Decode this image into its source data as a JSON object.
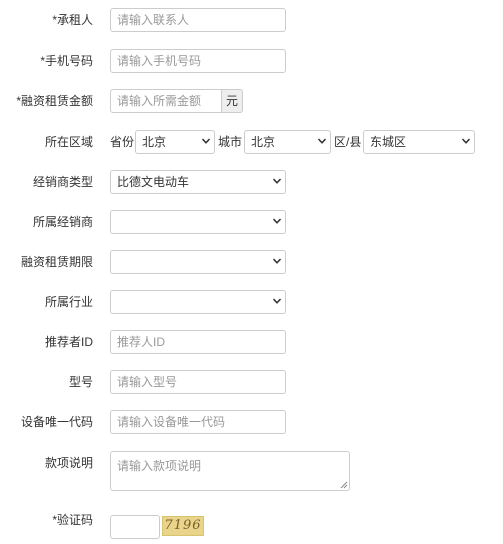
{
  "form": {
    "lessee": {
      "label": "*承租人",
      "placeholder": "请输入联系人"
    },
    "phone": {
      "label": "*手机号码",
      "placeholder": "请输入手机号码"
    },
    "amount": {
      "label": "*融资租赁金额",
      "placeholder": "请输入所需金额",
      "unit": "元"
    },
    "region": {
      "label": "所在区域",
      "province_label": "省份",
      "province_value": "北京",
      "city_label": "城市",
      "city_value": "北京",
      "district_label": "区/县",
      "district_value": "东城区"
    },
    "dealer_type": {
      "label": "经销商类型",
      "value": "比德文电动车"
    },
    "dealer": {
      "label": "所属经销商",
      "value": ""
    },
    "lease_term": {
      "label": "融资租赁期限",
      "value": ""
    },
    "industry": {
      "label": "所属行业",
      "value": ""
    },
    "referrer": {
      "label": "推荐者ID",
      "placeholder": "推荐人ID"
    },
    "model": {
      "label": "型号",
      "placeholder": "请输入型号"
    },
    "device_code": {
      "label": "设备唯一代码",
      "placeholder": "请输入设备唯一代码"
    },
    "description": {
      "label": "款项说明",
      "placeholder": "请输入款项说明"
    },
    "captcha": {
      "label": "*验证码",
      "value": "",
      "image_text": "7196"
    }
  },
  "colors": {
    "border": "#cccccc",
    "placeholder": "#999999",
    "addon_bg": "#eeeeee",
    "captcha_bg": "#e8d48a"
  }
}
